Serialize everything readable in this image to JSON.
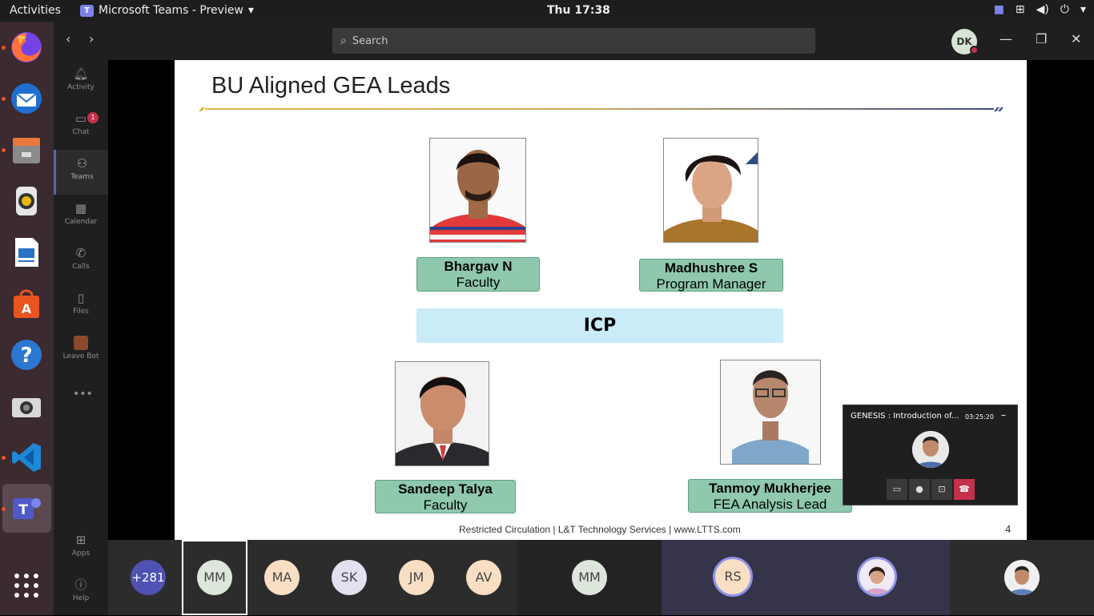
{
  "topbar": {
    "activities": "Activities",
    "app_name": "Microsoft Teams - Preview",
    "app_icon_letter": "T",
    "clock": "Thu 17:38"
  },
  "dock": {
    "items": [
      "firefox-icon",
      "thunderbird-icon",
      "files-icon",
      "rhythmbox-icon",
      "writer-icon",
      "software-icon",
      "help-icon",
      "camera-icon",
      "vscode-icon",
      "teams-icon"
    ]
  },
  "rail": {
    "items": [
      {
        "label": "Activity",
        "icon": "bell-icon"
      },
      {
        "label": "Chat",
        "icon": "chat-icon",
        "badge": "1"
      },
      {
        "label": "Teams",
        "icon": "teams-icon"
      },
      {
        "label": "Calendar",
        "icon": "calendar-icon"
      },
      {
        "label": "Calls",
        "icon": "phone-icon"
      },
      {
        "label": "Files",
        "icon": "file-icon"
      },
      {
        "label": "Leave Bot",
        "icon": "leave-bot-icon"
      },
      {
        "label": "Apps",
        "icon": "apps-icon"
      },
      {
        "label": "Help",
        "icon": "help-icon"
      }
    ]
  },
  "header": {
    "search_placeholder": "Search",
    "avatar_initials": "DK"
  },
  "slide": {
    "title": "BU Aligned GEA Leads",
    "people": [
      {
        "name": "Bhargav N",
        "role": "Faculty"
      },
      {
        "name": "Madhushree S",
        "role": "Program Manager"
      },
      {
        "name": "Sandeep Talya",
        "role": "Faculty"
      },
      {
        "name": "Tanmoy Mukherjee",
        "role": "FEA Analysis Lead"
      }
    ],
    "group_label": "ICP",
    "footer": "Restricted Circulation | L&T Technology Services | www.LTTS.com",
    "page_number": "4"
  },
  "mini_call": {
    "title": "GENESIS : Introduction of...",
    "timer": "03:25:20",
    "minimize": "–"
  },
  "participants": {
    "overflow": "+281",
    "tiles": [
      "MM",
      "MA",
      "SK",
      "JM",
      "AV",
      "MM",
      "RS"
    ],
    "colors": {
      "MM": "#dde6db",
      "MA": "#f8dfc4",
      "SK": "#e2e1ef",
      "JM": "#f8dfc4",
      "AV": "#f8dfc4",
      "RS": "#f8dfc4"
    }
  }
}
